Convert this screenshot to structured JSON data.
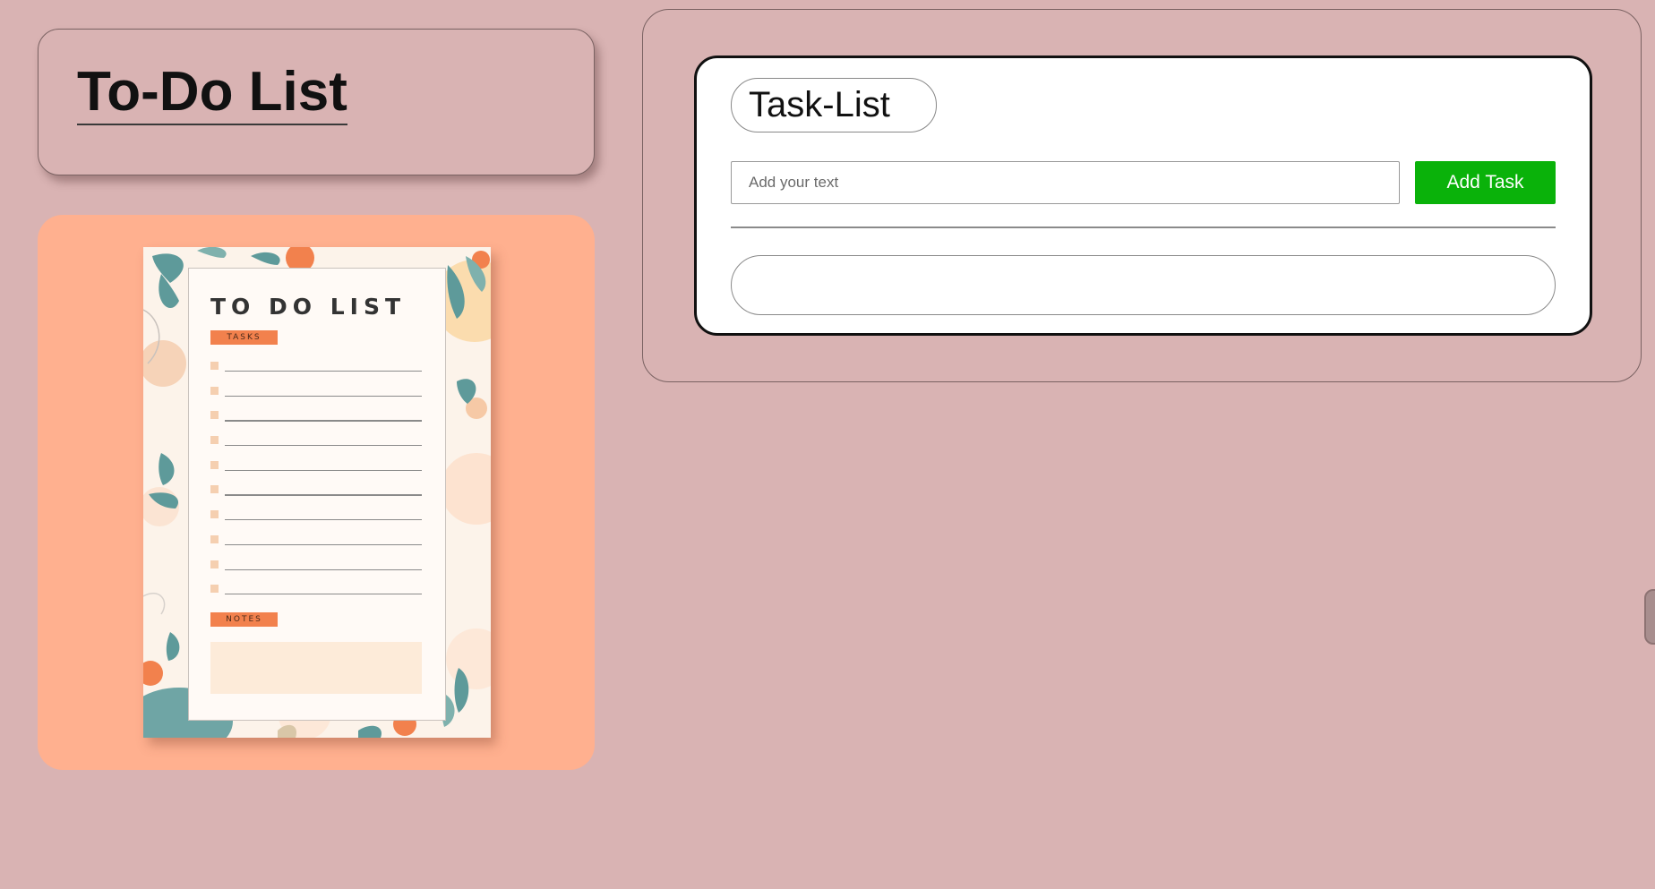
{
  "header": {
    "title": "To-Do List"
  },
  "illustration": {
    "title": "TO DO LIST",
    "tasks_tag": "TASKS",
    "notes_tag": "NOTES",
    "task_line_count": 10
  },
  "task_panel": {
    "title": "Task-List",
    "input_placeholder": "Add your text",
    "input_value": "",
    "add_button_label": "Add Task",
    "tasks": []
  },
  "colors": {
    "page_background": "#d9b3b3",
    "image_card_background": "#ffb08f",
    "add_button": "#0ab20a",
    "card_background": "#ffffff"
  }
}
